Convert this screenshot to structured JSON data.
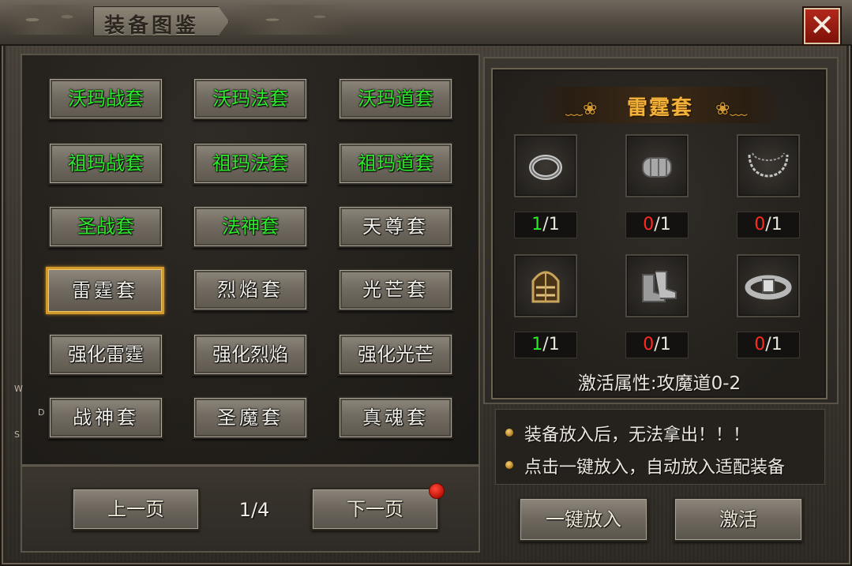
{
  "window": {
    "title": "装备图鉴",
    "close_label": "✕"
  },
  "side_letters": [
    "W",
    "D",
    "S"
  ],
  "sets": [
    {
      "label": "沃玛战套",
      "color": "green"
    },
    {
      "label": "沃玛法套",
      "color": "green"
    },
    {
      "label": "沃玛道套",
      "color": "green"
    },
    {
      "label": "祖玛战套",
      "color": "green"
    },
    {
      "label": "祖玛法套",
      "color": "green"
    },
    {
      "label": "祖玛道套",
      "color": "green"
    },
    {
      "label": "圣战套",
      "color": "green"
    },
    {
      "label": "法神套",
      "color": "green"
    },
    {
      "label": "天尊套",
      "color": "white"
    },
    {
      "label": "雷霆套",
      "color": "white",
      "selected": true
    },
    {
      "label": "烈焰套",
      "color": "white"
    },
    {
      "label": "光芒套",
      "color": "white"
    },
    {
      "label": "强化雷霆",
      "color": "white"
    },
    {
      "label": "强化烈焰",
      "color": "white"
    },
    {
      "label": "强化光芒",
      "color": "white"
    },
    {
      "label": "战神套",
      "color": "white"
    },
    {
      "label": "圣魔套",
      "color": "white"
    },
    {
      "label": "真魂套",
      "color": "white"
    }
  ],
  "pagination": {
    "prev_label": "上一页",
    "next_label": "下一页",
    "page": "1/4",
    "next_has_alert": true
  },
  "detail": {
    "set_name": "雷霆套",
    "items": [
      {
        "icon": "ring-icon",
        "have": "1",
        "need": "/1",
        "status": "complete"
      },
      {
        "icon": "bracelet-icon",
        "have": "0",
        "need": "/1",
        "status": "missing"
      },
      {
        "icon": "necklace-icon",
        "have": "0",
        "need": "/1",
        "status": "missing"
      },
      {
        "icon": "helmet-icon",
        "have": "1",
        "need": "/1",
        "status": "complete"
      },
      {
        "icon": "boots-icon",
        "have": "0",
        "need": "/1",
        "status": "missing"
      },
      {
        "icon": "belt-icon",
        "have": "0",
        "need": "/1",
        "status": "missing"
      }
    ],
    "activation_attr": "激活属性:攻魔道0-2"
  },
  "notes": [
    "装备放入后，无法拿出！！！",
    "点击一键放入，自动放入适配装备"
  ],
  "actions": {
    "auto_put_label": "一键放入",
    "activate_label": "激活"
  },
  "colors": {
    "green": "#2ee82c",
    "red": "#ff2a1e",
    "gold": "#f2b23a",
    "selected_border": "#d19a2a"
  }
}
